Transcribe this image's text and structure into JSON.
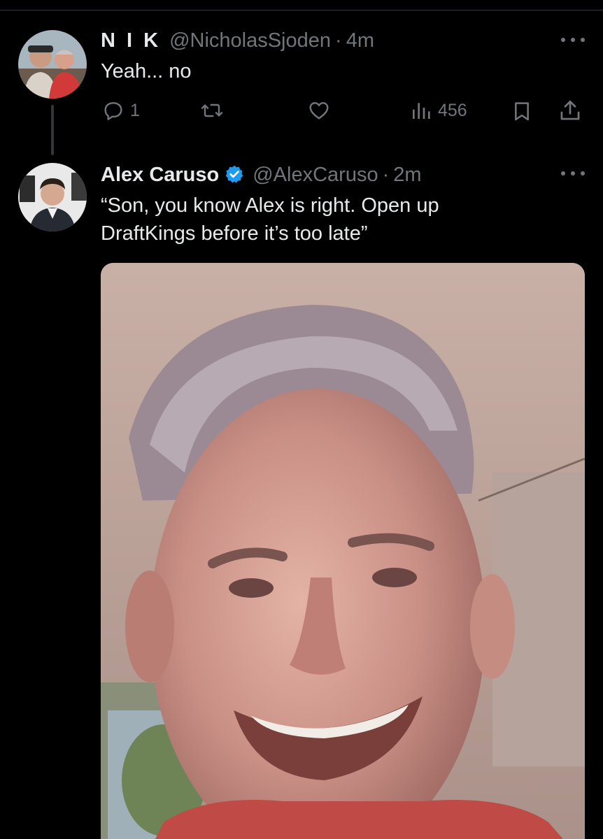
{
  "reply": {
    "display_name": "N I K",
    "handle": "@NicholasSjoden",
    "separator": "·",
    "time": "4m",
    "text": "Yeah... no",
    "actions": {
      "reply_count": "1",
      "retweet_count": "",
      "like_count": "",
      "views_count": "456"
    },
    "icons": [
      "reply-icon",
      "retweet-icon",
      "like-icon",
      "views-icon",
      "bookmark-icon",
      "share-icon",
      "more-icon"
    ]
  },
  "quoted": {
    "display_name": "Alex Caruso",
    "verified": true,
    "handle": "@AlexCaruso",
    "separator": "·",
    "time": "2m",
    "text_line1": "“Son, you know Alex is right. Open up",
    "text_line2": "DraftKings before it’s too late”",
    "has_media": true
  },
  "colors": {
    "background": "#000000",
    "text_primary": "#e7e9ea",
    "text_secondary": "#71767b",
    "verified_blue": "#1d9bf0",
    "divider": "#2f3336"
  }
}
